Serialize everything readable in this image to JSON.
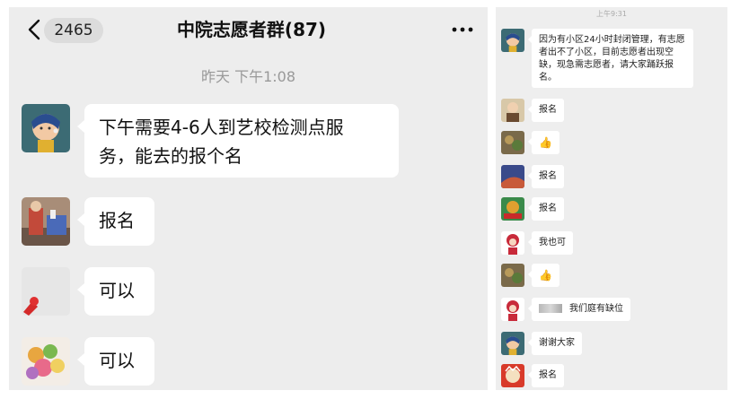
{
  "left_panel": {
    "back_badge": "2465",
    "title": "中院志愿者群(87)",
    "timestamp": "昨天 下午1:08",
    "messages": [
      {
        "text_line1": "下午需要4-6人到艺校检测点服",
        "text_line2": "务，能去的报个名"
      },
      {
        "text": "报名"
      },
      {
        "text": "可以"
      },
      {
        "text": "可以"
      }
    ]
  },
  "right_panel": {
    "timestamp": "上午9:31",
    "messages": [
      {
        "text": "因为有小区24小时封闭管理，有志愿者出不了小区，目前志愿者出现空缺，现急需志愿者，请大家踊跃报名。"
      },
      {
        "text": "报名"
      },
      {
        "icon": "thumbs-up-icon",
        "text": "👍"
      },
      {
        "text": "报名"
      },
      {
        "text": "报名"
      },
      {
        "text": "我也可"
      },
      {
        "icon": "thumbs-up-icon",
        "text": "👍"
      },
      {
        "text": "我们庭有缺位"
      },
      {
        "text": "谢谢大家"
      },
      {
        "text": "报名"
      }
    ]
  },
  "colors": {
    "chat_background": "#ededed",
    "bubble": "#ffffff",
    "timestamp_text": "#999999"
  }
}
